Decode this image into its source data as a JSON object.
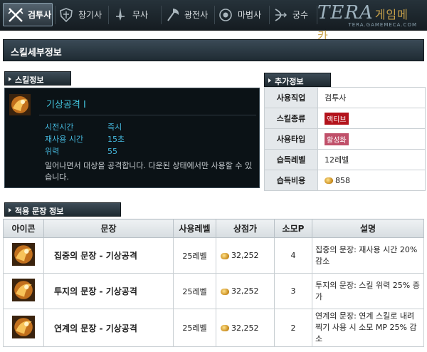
{
  "tabs": [
    {
      "label": "검투사",
      "icon": "crossed-swords-icon",
      "active": true
    },
    {
      "label": "창기사",
      "icon": "shield-crest-icon",
      "active": false
    },
    {
      "label": "무사",
      "icon": "blade-icon",
      "active": false
    },
    {
      "label": "광전사",
      "icon": "axe-icon",
      "active": false
    },
    {
      "label": "마법사",
      "icon": "magic-orb-icon",
      "active": false
    },
    {
      "label": "궁수",
      "icon": "bow-icon",
      "active": false
    }
  ],
  "logo": {
    "text": "TERA",
    "korean": "게임메카",
    "sub": "TERA.GAMEMECA.COM"
  },
  "page_title": "스킬세부정보",
  "skill_section_label": "스킬정보",
  "skill": {
    "name": "기상공격 I",
    "stats": [
      {
        "label": "시전시간",
        "value": "즉시"
      },
      {
        "label": "재사용 시간",
        "value": "15초"
      },
      {
        "label": "위력",
        "value": "55"
      }
    ],
    "description": "일어나면서 대상을 공격합니다. 다운된 상태에서만 사용할 수 있습니다."
  },
  "extra_section_label": "추가정보",
  "extra_info": [
    {
      "key": "사용직업",
      "value": "검투사"
    },
    {
      "key": "스킬종류",
      "value": "액티브",
      "badge_color": "#b3131c"
    },
    {
      "key": "사용타입",
      "value": "활성화",
      "badge_color": "#c0506a"
    },
    {
      "key": "습득레벨",
      "value": "12레벨"
    },
    {
      "key": "습득비용",
      "value": "858",
      "coin": true
    }
  ],
  "glyph_section_label": "적용 문장 정보",
  "glyph_table": {
    "headers": [
      "아이콘",
      "문장",
      "사용레벨",
      "상점가",
      "소모P",
      "설명"
    ],
    "rows": [
      {
        "name": "집중의 문장 - 기상공격",
        "level": "25레벨",
        "price": "32,252",
        "points": "4",
        "desc": "집중의 문장: 재사용 시간 20% 감소"
      },
      {
        "name": "투지의 문장 - 기상공격",
        "level": "25레벨",
        "price": "32,252",
        "points": "3",
        "desc": "투지의 문장: 스킬 위력 25% 증가"
      },
      {
        "name": "연계의 문장 - 기상공격",
        "level": "25레벨",
        "price": "32,252",
        "points": "2",
        "desc": "연계의 문장: 연계 스킬로 내려찍기 사용 시 소모 MP 25% 감소"
      }
    ]
  },
  "colors": {
    "skill_name": "#43c7e0",
    "stat_text": "#45b7dc",
    "header_dark": "#1f2b33"
  }
}
